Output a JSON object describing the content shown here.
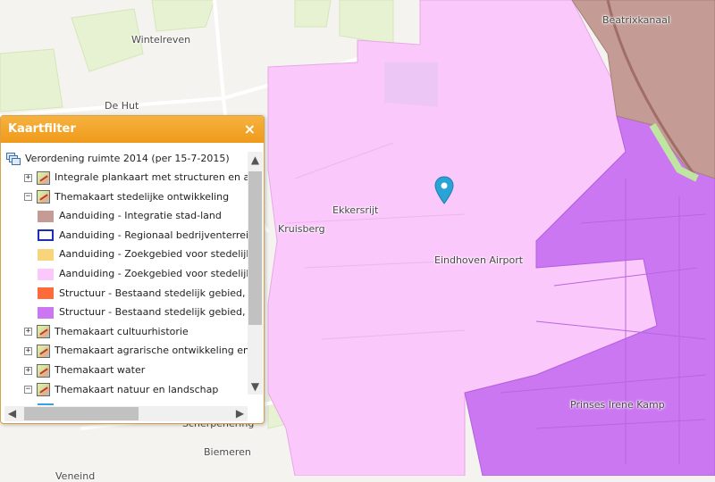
{
  "map": {
    "labels": {
      "wintelreven": "Wintelreven",
      "de_hut": "De Hut",
      "beatrixkanaal": "Beatrixkanaal",
      "ekkersrijt": "Ekkersrijt",
      "kruisberg": "Kruisberg",
      "eindhoven_airport": "Eindhoven Airport",
      "prinses_irene_kamp": "Prinses Irene Kamp",
      "biemeren": "Biemeren",
      "scherpenering": "Scherpenering",
      "veneind": "Veneind"
    },
    "colors": {
      "background": "#f4f3ef",
      "zoekgebied": "#fbc8fb",
      "bestaand_stedelijk": "#cc77f2",
      "integratie": "#c49c95",
      "fields": "#e7f2d2"
    }
  },
  "panel": {
    "title": "Kaartfilter",
    "close": "×",
    "root": "Verordening ruimte 2014 (per 15-7-2015)",
    "items": [
      {
        "type": "group",
        "expand": "+",
        "label": "Integrale plankaart met structuren en aanduidingen"
      },
      {
        "type": "group",
        "expand": "−",
        "label": "Themakaart stedelijke ontwikkeling"
      },
      {
        "type": "legend",
        "label": "Aanduiding - Integratie stad-land",
        "color": "#c49c95",
        "style": "fill"
      },
      {
        "type": "legend",
        "label": "Aanduiding - Regionaal bedrijventerrein",
        "color": "#1a2fb3",
        "style": "outline"
      },
      {
        "type": "legend",
        "label": "Aanduiding - Zoekgebied voor stedelijke ontwikkeling",
        "color": "#f8d57a",
        "style": "fill"
      },
      {
        "type": "legend",
        "label": "Aanduiding - Zoekgebied voor stedelijke ontwikkeling",
        "color": "#fbc8fb",
        "style": "fill"
      },
      {
        "type": "legend",
        "label": "Structuur - Bestaand stedelijk gebied, kern",
        "color": "#ff6a3a",
        "style": "fill"
      },
      {
        "type": "legend",
        "label": "Structuur - Bestaand stedelijk gebied, stedelijk",
        "color": "#cc77f2",
        "style": "fill"
      },
      {
        "type": "group",
        "expand": "+",
        "label": "Themakaart cultuurhistorie"
      },
      {
        "type": "group",
        "expand": "+",
        "label": "Themakaart agrarische ontwikkeling en wind"
      },
      {
        "type": "group",
        "expand": "+",
        "label": "Themakaart water"
      },
      {
        "type": "group",
        "expand": "−",
        "label": "Themakaart natuur en landschap"
      }
    ],
    "scroll": {
      "up": "▲",
      "down": "▼",
      "left": "◀",
      "right": "▶"
    }
  }
}
